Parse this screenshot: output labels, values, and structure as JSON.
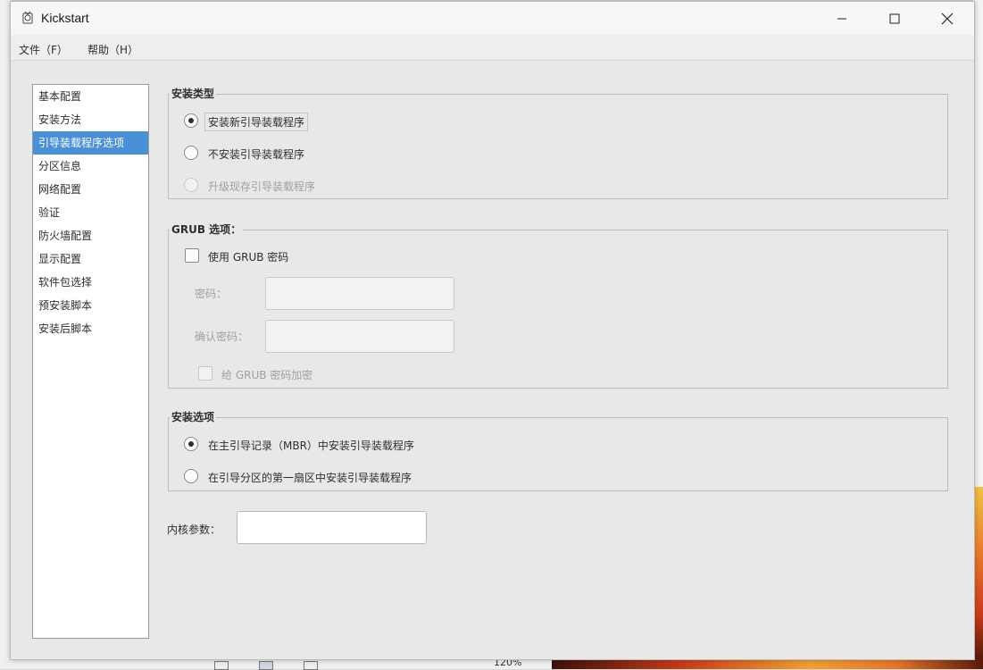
{
  "window": {
    "title": "Kickstart"
  },
  "menubar": [
    {
      "label": "文件（F）"
    },
    {
      "label": "帮助（H）"
    }
  ],
  "sidebar": {
    "items": [
      {
        "label": "基本配置"
      },
      {
        "label": "安装方法"
      },
      {
        "label": "引导装载程序选项",
        "selected": true
      },
      {
        "label": "分区信息"
      },
      {
        "label": "网络配置"
      },
      {
        "label": "验证"
      },
      {
        "label": "防火墙配置"
      },
      {
        "label": "显示配置"
      },
      {
        "label": "软件包选择"
      },
      {
        "label": "预安装脚本"
      },
      {
        "label": "安装后脚本"
      }
    ]
  },
  "install_type": {
    "title": "安装类型",
    "options": [
      {
        "label": "安装新引导装载程序",
        "checked": true,
        "enabled": true
      },
      {
        "label": "不安装引导装载程序",
        "checked": false,
        "enabled": true
      },
      {
        "label": "升级现存引导装载程序",
        "checked": false,
        "enabled": false
      }
    ]
  },
  "grub": {
    "title": "GRUB 选项：",
    "use_password_label": "使用 GRUB 密码",
    "password_label": "密码：",
    "password_value": "",
    "confirm_label": "确认密码：",
    "confirm_value": "",
    "encrypt_label": "给 GRUB 密码加密"
  },
  "install_options": {
    "title": "安装选项",
    "options": [
      {
        "label": "在主引导记录（MBR）中安装引导装载程序",
        "checked": true
      },
      {
        "label": "在引导分区的第一扇区中安装引导装载程序",
        "checked": false
      }
    ]
  },
  "kernel": {
    "label": "内核参数：",
    "value": ""
  },
  "background": {
    "zoom_text": "120%"
  },
  "colors": {
    "selection": "#4a90d9",
    "window_bg": "#e8e8e6"
  }
}
